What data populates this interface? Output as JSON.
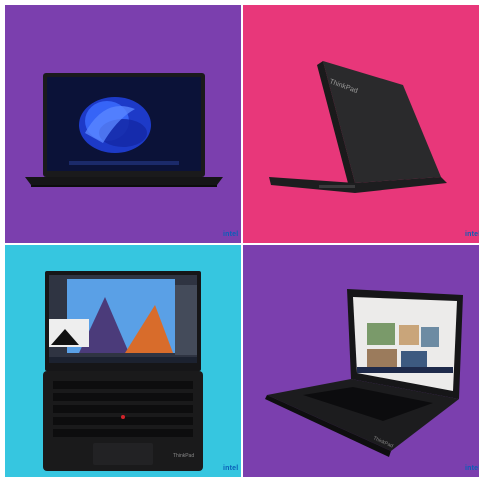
{
  "colors": {
    "purple": "#7b3fae",
    "pink": "#e8377a",
    "cyan": "#36c6e0",
    "laptop_dark": "#1c1c1e"
  },
  "tiles": [
    {
      "badge": "intel"
    },
    {
      "badge": "intel"
    },
    {
      "badge": "intel"
    },
    {
      "badge": "intel"
    }
  ]
}
